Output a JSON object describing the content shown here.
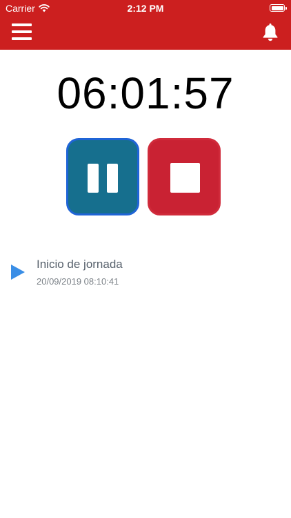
{
  "status_bar": {
    "carrier": "Carrier",
    "time": "2:12 PM"
  },
  "nav": {
    "menu_icon": "hamburger-menu-icon",
    "bell_icon": "bell-icon",
    "background_color": "#cc1f1f"
  },
  "timer": {
    "elapsed": "06:01:57"
  },
  "controls": {
    "pause_icon": "pause-icon",
    "pause_color": "#166f8e",
    "stop_icon": "stop-icon",
    "stop_color": "#c92233"
  },
  "events": [
    {
      "icon": "play-icon",
      "title": "Inicio de jornada",
      "timestamp": "20/09/2019 08:10:41"
    }
  ]
}
